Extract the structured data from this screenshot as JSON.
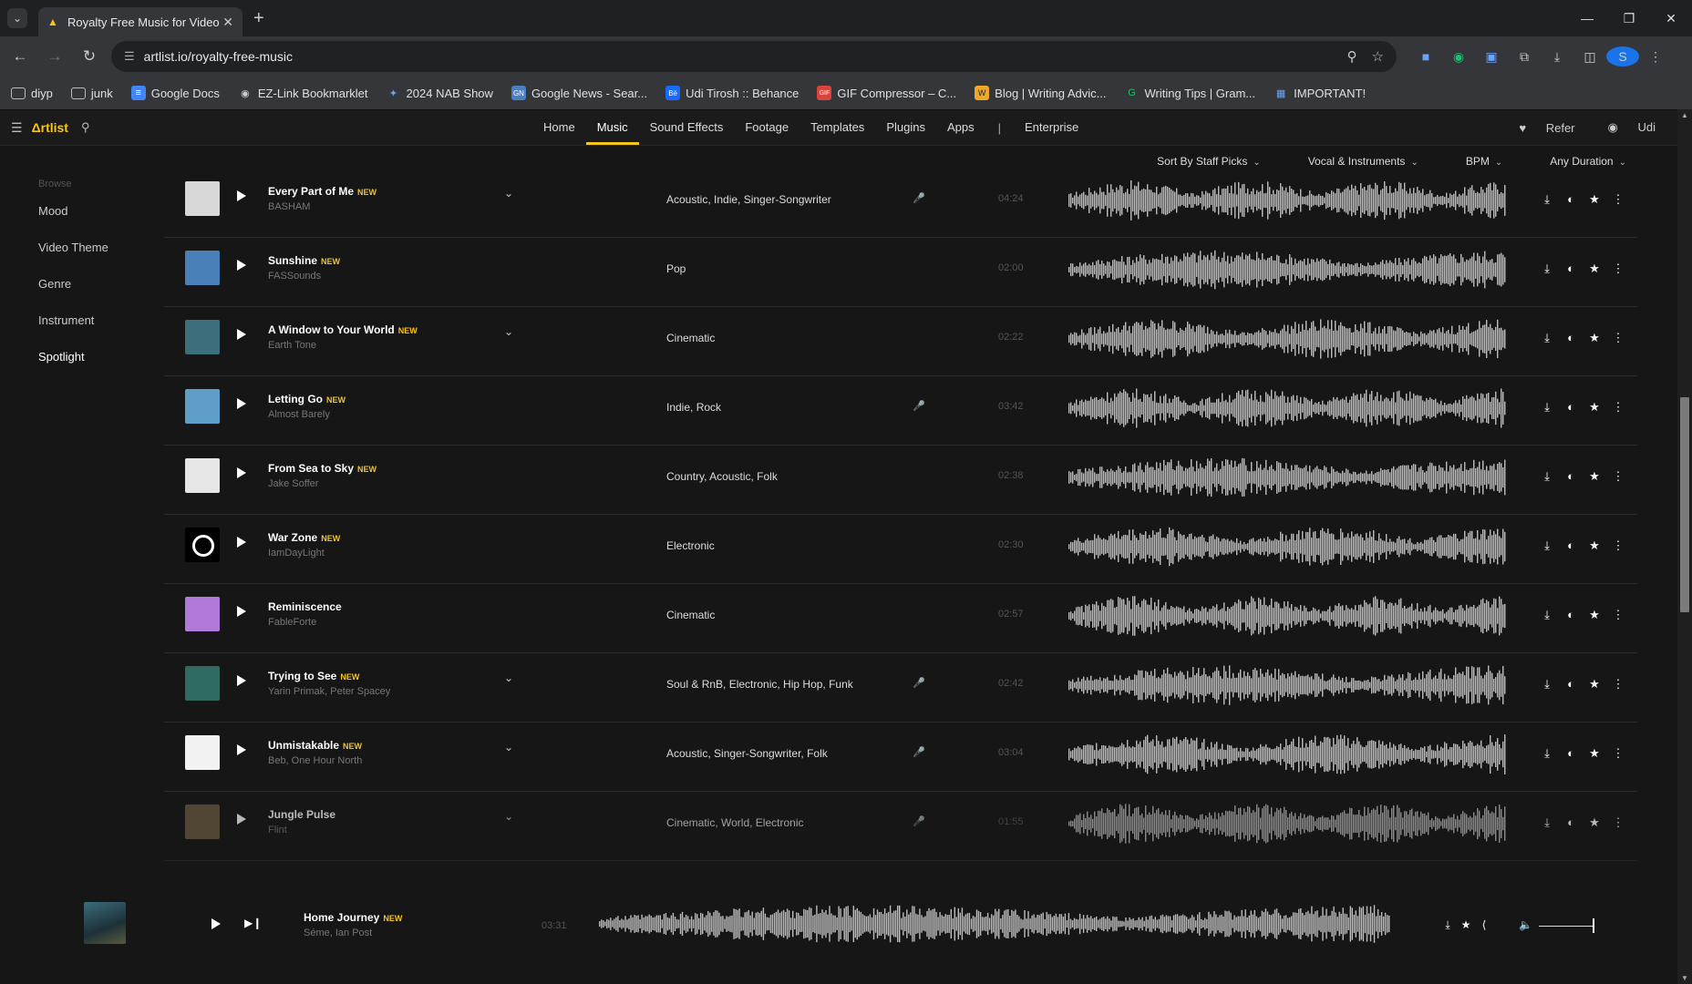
{
  "browser": {
    "tab_title": "Royalty Free Music for Video Cr",
    "url": "artlist.io/royalty-free-music",
    "profile_initial": "S",
    "bookmarks": [
      "diyp",
      "junk",
      "Google Docs",
      "EZ-Link Bookmarklet",
      "2024 NAB Show",
      "Google News - Sear...",
      "Udi Tirosh :: Behance",
      "GIF Compressor – C...",
      "Blog | Writing Advic...",
      "Writing Tips | Gram...",
      "IMPORTANT!"
    ]
  },
  "site": {
    "logo": "Δrtlist",
    "nav": [
      "Home",
      "Music",
      "Sound Effects",
      "Footage",
      "Templates",
      "Plugins",
      "Apps",
      "|",
      "Enterprise"
    ],
    "active_nav": "Music",
    "refer": "Refer",
    "user": "Udi"
  },
  "sidebar": {
    "heading": "Browse",
    "items": [
      "Mood",
      "Video Theme",
      "Genre",
      "Instrument",
      "Spotlight"
    ]
  },
  "filters": [
    "Sort By Staff Picks",
    "Vocal & Instruments",
    "BPM",
    "Any Duration"
  ],
  "tracks": [
    {
      "title": "Every Part of Me",
      "new": "NEW",
      "artist": "BASHAM",
      "genres": "Acoustic, Indie, Singer-Songwriter",
      "duration": "04:24",
      "vocal": true,
      "expand": true,
      "cover": "#d8d8d8"
    },
    {
      "title": "Sunshine",
      "new": "NEW",
      "artist": "FASSounds",
      "genres": "Pop",
      "duration": "02:00",
      "vocal": false,
      "expand": false,
      "cover": "#4a7fb8"
    },
    {
      "title": "A Window to Your World",
      "new": "NEW",
      "artist": "Earth Tone",
      "genres": "Cinematic",
      "duration": "02:22",
      "vocal": false,
      "expand": true,
      "cover": "#3d6e7c"
    },
    {
      "title": "Letting Go",
      "new": "NEW",
      "artist": "Almost Barely",
      "genres": "Indie, Rock",
      "duration": "03:42",
      "vocal": true,
      "expand": false,
      "cover": "#5f9ec9"
    },
    {
      "title": "From Sea to Sky",
      "new": "NEW",
      "artist": "Jake Soffer",
      "genres": "Country, Acoustic, Folk",
      "duration": "02:38",
      "vocal": false,
      "expand": false,
      "cover": "#e6e6e6"
    },
    {
      "title": "War Zone",
      "new": "NEW",
      "artist": "IamDayLight",
      "genres": "Electronic",
      "duration": "02:30",
      "vocal": false,
      "expand": false,
      "cover": "#000000"
    },
    {
      "title": "Reminiscence",
      "new": "",
      "artist": "FableForte",
      "genres": "Cinematic",
      "duration": "02:57",
      "vocal": false,
      "expand": false,
      "cover": "#b17ad8"
    },
    {
      "title": "Trying to See",
      "new": "NEW",
      "artist": "Yarin Primak, Peter Spacey",
      "genres": "Soul & RnB, Electronic, Hip Hop, Funk",
      "duration": "02:42",
      "vocal": true,
      "expand": true,
      "cover": "#2f6b5f"
    },
    {
      "title": "Unmistakable",
      "new": "NEW",
      "artist": "Beb, One Hour North",
      "genres": "Acoustic, Singer-Songwriter, Folk",
      "duration": "03:04",
      "vocal": true,
      "expand": true,
      "cover": "#f2f2f2"
    },
    {
      "title": "Jungle Pulse",
      "new": "",
      "artist": "Flint",
      "genres": "Cinematic, World, Electronic",
      "duration": "01:55",
      "vocal": true,
      "expand": true,
      "cover": "#6b5a42"
    }
  ],
  "player": {
    "title": "Home Journey",
    "new": "NEW",
    "artist": "Séme, Ian Post",
    "duration": "03:31"
  }
}
